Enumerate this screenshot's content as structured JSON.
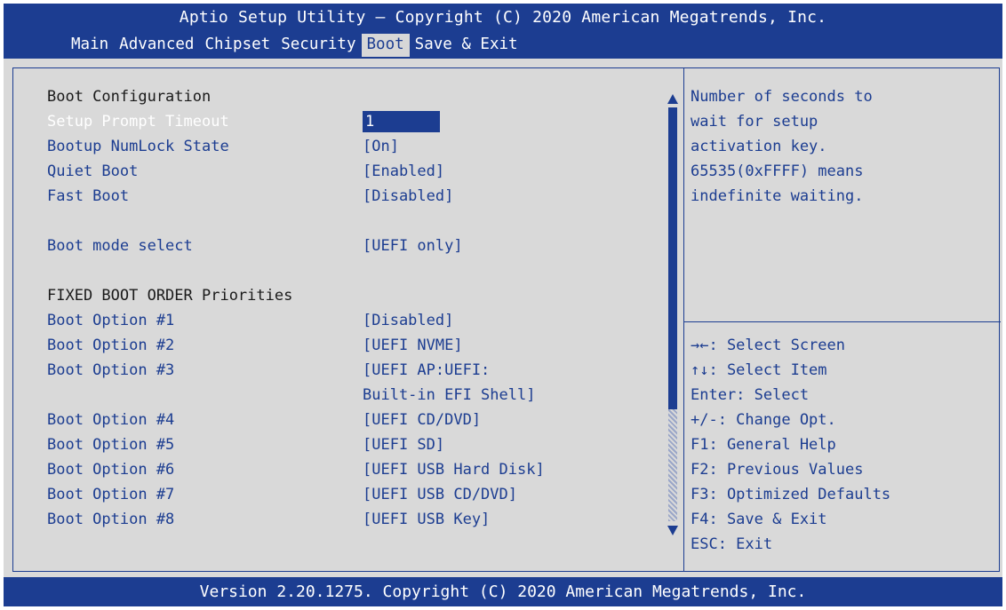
{
  "header": {
    "title": "Aptio Setup Utility – Copyright (C) 2020 American Megatrends, Inc."
  },
  "menu": {
    "items": [
      "Main",
      "Advanced",
      "Chipset",
      "Security",
      "Boot",
      "Save & Exit"
    ],
    "active": "Boot"
  },
  "settings": {
    "section_title": "Boot Configuration",
    "setup_prompt_timeout": {
      "label": "Setup Prompt Timeout",
      "value": "1"
    },
    "numlock": {
      "label": "Bootup NumLock State",
      "value": "[On]"
    },
    "quiet_boot": {
      "label": "Quiet Boot",
      "value": "[Enabled]"
    },
    "fast_boot": {
      "label": "Fast Boot",
      "value": "[Disabled]"
    },
    "boot_mode": {
      "label": "Boot mode select",
      "value": "[UEFI only]"
    },
    "fixed_order_title": "FIXED BOOT ORDER Priorities",
    "boot_options": [
      {
        "label": "Boot Option #1",
        "value": "[Disabled]"
      },
      {
        "label": "Boot Option #2",
        "value": "[UEFI NVME]"
      },
      {
        "label": "Boot Option #3",
        "value": "[UEFI AP:UEFI:",
        "value2": "Built-in EFI Shell]"
      },
      {
        "label": "Boot Option #4",
        "value": "[UEFI CD/DVD]"
      },
      {
        "label": "Boot Option #5",
        "value": "[UEFI SD]"
      },
      {
        "label": "Boot Option #6",
        "value": "[UEFI USB Hard Disk]"
      },
      {
        "label": "Boot Option #7",
        "value": "[UEFI USB CD/DVD]"
      },
      {
        "label": "Boot Option #8",
        "value": "[UEFI USB Key]"
      }
    ]
  },
  "help": {
    "description": [
      "Number of seconds to",
      "wait for setup",
      "activation key.",
      "65535(0xFFFF) means",
      "indefinite waiting."
    ],
    "keys": [
      "→←: Select Screen",
      "↑↓: Select Item",
      "Enter: Select",
      "+/-: Change Opt.",
      "F1: General Help",
      "F2: Previous Values",
      "F3: Optimized Defaults",
      "F4: Save & Exit",
      "ESC: Exit"
    ]
  },
  "footer": {
    "text": "Version 2.20.1275. Copyright (C) 2020 American Megatrends, Inc."
  },
  "colors": {
    "accent": "#1c3d91",
    "background": "#d9d9d9"
  }
}
